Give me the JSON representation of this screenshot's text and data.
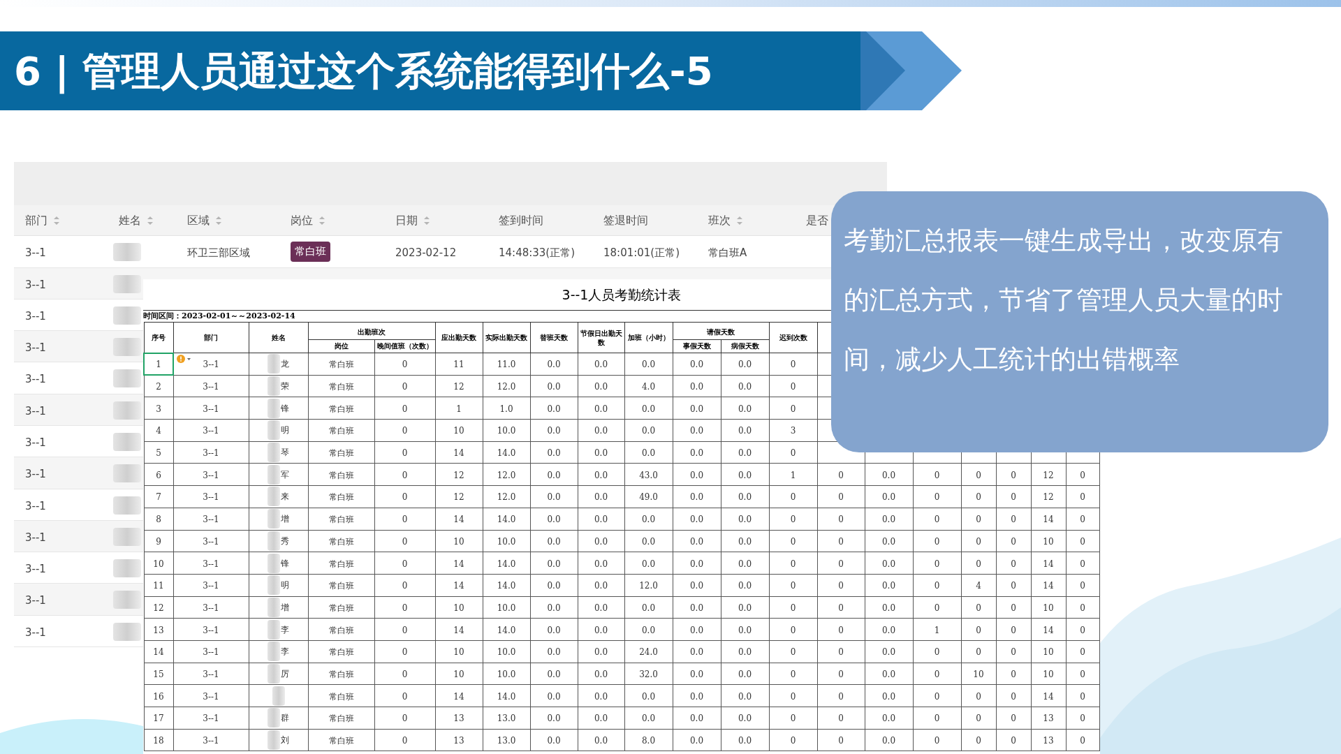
{
  "slide_title": "6 | 管理人员通过这个系统能得到什么-5",
  "list": {
    "columns": [
      {
        "label": "部门",
        "sortable": true
      },
      {
        "label": "姓名",
        "sortable": true
      },
      {
        "label": "区域",
        "sortable": true
      },
      {
        "label": "岗位",
        "sortable": true
      },
      {
        "label": "日期",
        "sortable": true
      },
      {
        "label": "签到时间",
        "sortable": false
      },
      {
        "label": "签退时间",
        "sortable": false
      },
      {
        "label": "班次",
        "sortable": true
      },
      {
        "label": "是否"
      }
    ],
    "rows": [
      {
        "dept": "3--1",
        "area": "环卫三部区域",
        "post": "常白班",
        "date": "2023-02-12",
        "sign_in": "14:48:33(正常)",
        "sign_out": "18:01:01(正常)",
        "shift": "常白班A"
      },
      {
        "dept": "3--1"
      },
      {
        "dept": "3--1"
      },
      {
        "dept": "3--1"
      },
      {
        "dept": "3--1"
      },
      {
        "dept": "3--1"
      },
      {
        "dept": "3--1"
      },
      {
        "dept": "3--1"
      },
      {
        "dept": "3--1"
      },
      {
        "dept": "3--1"
      },
      {
        "dept": "3--1"
      },
      {
        "dept": "3--1"
      },
      {
        "dept": "3--1"
      }
    ]
  },
  "report": {
    "title": "3--1人员考勤统计表",
    "period": "时间区间：2023-02-01～～2023-02-14",
    "header_groups": [
      {
        "label": "出勤班次"
      },
      {
        "label": "请假天数"
      }
    ],
    "columns": [
      {
        "label": "序号"
      },
      {
        "label": "部门"
      },
      {
        "label": "姓名"
      },
      {
        "label": "岗位"
      },
      {
        "label": "晚间值班（次数）"
      },
      {
        "label": "应出勤天数"
      },
      {
        "label": "实际出勤天数"
      },
      {
        "label": "替班天数"
      },
      {
        "label": "节假日出勤天数"
      },
      {
        "label": "加班（小时）"
      },
      {
        "label": "事假天数"
      },
      {
        "label": "病假天数"
      },
      {
        "label": "迟到次数"
      }
    ],
    "rows": [
      {
        "selected": true,
        "warning": true,
        "cells": [
          "1",
          "3--1",
          "龙",
          "常白班",
          "0",
          "11",
          "11.0",
          "0.0",
          "0.0",
          "0.0",
          "0.0",
          "0.0",
          "0"
        ]
      },
      {
        "selected": false,
        "warning": false,
        "cells": [
          "2",
          "3--1",
          "荣",
          "常白班",
          "0",
          "12",
          "12.0",
          "0.0",
          "0.0",
          "4.0",
          "0.0",
          "0.0",
          "0"
        ]
      },
      {
        "selected": false,
        "warning": false,
        "cells": [
          "3",
          "3--1",
          "锋",
          "常白班",
          "0",
          "1",
          "1.0",
          "0.0",
          "0.0",
          "0.0",
          "0.0",
          "0.0",
          "0"
        ]
      },
      {
        "selected": false,
        "warning": false,
        "cells": [
          "4",
          "3--1",
          "明",
          "常白班",
          "0",
          "10",
          "10.0",
          "0.0",
          "0.0",
          "0.0",
          "0.0",
          "0.0",
          "3"
        ]
      },
      {
        "selected": false,
        "warning": false,
        "cells": [
          "5",
          "3--1",
          "琴",
          "常白班",
          "0",
          "14",
          "14.0",
          "0.0",
          "0.0",
          "0.0",
          "0.0",
          "0.0",
          "0"
        ]
      },
      {
        "selected": false,
        "warning": false,
        "cells": [
          "6",
          "3--1",
          "军",
          "常白班",
          "0",
          "12",
          "12.0",
          "0.0",
          "0.0",
          "43.0",
          "0.0",
          "0.0",
          "1",
          "0",
          "0.0",
          "0",
          "0",
          "0",
          "12",
          "0"
        ]
      },
      {
        "selected": false,
        "warning": false,
        "cells": [
          "7",
          "3--1",
          "来",
          "常白班",
          "0",
          "12",
          "12.0",
          "0.0",
          "0.0",
          "49.0",
          "0.0",
          "0.0",
          "0",
          "0",
          "0.0",
          "0",
          "0",
          "0",
          "12",
          "0"
        ]
      },
      {
        "selected": false,
        "warning": false,
        "cells": [
          "8",
          "3--1",
          "增",
          "常白班",
          "0",
          "14",
          "14.0",
          "0.0",
          "0.0",
          "0.0",
          "0.0",
          "0.0",
          "0",
          "0",
          "0.0",
          "0",
          "0",
          "0",
          "14",
          "0"
        ]
      },
      {
        "selected": false,
        "warning": false,
        "cells": [
          "9",
          "3--1",
          "秀",
          "常白班",
          "0",
          "10",
          "10.0",
          "0.0",
          "0.0",
          "0.0",
          "0.0",
          "0.0",
          "0",
          "0",
          "0.0",
          "0",
          "0",
          "0",
          "10",
          "0"
        ]
      },
      {
        "selected": false,
        "warning": false,
        "cells": [
          "10",
          "3--1",
          "锋",
          "常白班",
          "0",
          "14",
          "14.0",
          "0.0",
          "0.0",
          "0.0",
          "0.0",
          "0.0",
          "0",
          "0",
          "0.0",
          "0",
          "0",
          "0",
          "14",
          "0"
        ]
      },
      {
        "selected": false,
        "warning": false,
        "cells": [
          "11",
          "3--1",
          "明",
          "常白班",
          "0",
          "14",
          "14.0",
          "0.0",
          "0.0",
          "12.0",
          "0.0",
          "0.0",
          "0",
          "0",
          "0.0",
          "0",
          "4",
          "0",
          "14",
          "0"
        ]
      },
      {
        "selected": false,
        "warning": false,
        "cells": [
          "12",
          "3--1",
          "增",
          "常白班",
          "0",
          "10",
          "10.0",
          "0.0",
          "0.0",
          "0.0",
          "0.0",
          "0.0",
          "0",
          "0",
          "0.0",
          "0",
          "0",
          "0",
          "10",
          "0"
        ]
      },
      {
        "selected": false,
        "warning": false,
        "cells": [
          "13",
          "3--1",
          "李",
          "常白班",
          "0",
          "14",
          "14.0",
          "0.0",
          "0.0",
          "0.0",
          "0.0",
          "0.0",
          "0",
          "0",
          "0.0",
          "1",
          "0",
          "0",
          "14",
          "0"
        ]
      },
      {
        "selected": false,
        "warning": false,
        "cells": [
          "14",
          "3--1",
          "李",
          "常白班",
          "0",
          "10",
          "10.0",
          "0.0",
          "0.0",
          "24.0",
          "0.0",
          "0.0",
          "0",
          "0",
          "0.0",
          "0",
          "0",
          "0",
          "10",
          "0"
        ]
      },
      {
        "selected": false,
        "warning": false,
        "cells": [
          "15",
          "3--1",
          "厉",
          "常白班",
          "0",
          "10",
          "10.0",
          "0.0",
          "0.0",
          "32.0",
          "0.0",
          "0.0",
          "0",
          "0",
          "0.0",
          "0",
          "10",
          "0",
          "10",
          "0"
        ]
      },
      {
        "selected": false,
        "warning": false,
        "cells": [
          "16",
          "3--1",
          "",
          "常白班",
          "0",
          "14",
          "14.0",
          "0.0",
          "0.0",
          "0.0",
          "0.0",
          "0.0",
          "0",
          "0",
          "0.0",
          "0",
          "0",
          "0",
          "14",
          "0"
        ]
      },
      {
        "selected": false,
        "warning": false,
        "cells": [
          "17",
          "3--1",
          "群",
          "常白班",
          "0",
          "13",
          "13.0",
          "0.0",
          "0.0",
          "0.0",
          "0.0",
          "0.0",
          "0",
          "0",
          "0.0",
          "0",
          "0",
          "0",
          "13",
          "0"
        ]
      },
      {
        "selected": false,
        "warning": false,
        "cells": [
          "18",
          "3--1",
          "刘",
          "常白班",
          "0",
          "13",
          "13.0",
          "0.0",
          "0.0",
          "8.0",
          "0.0",
          "0.0",
          "0",
          "0",
          "0.0",
          "0",
          "0",
          "0",
          "13",
          "0"
        ]
      }
    ]
  },
  "callout": "考勤汇总报表一键生成导出，改变原有的汇总方式，节省了管理人员大量的时间，减少人工统计的出错概率"
}
